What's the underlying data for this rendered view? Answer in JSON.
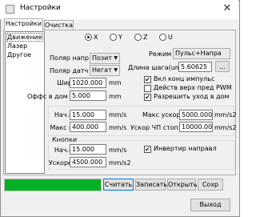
{
  "window": {
    "title": "Настройки",
    "close_glyph": "✕"
  },
  "tabs": [
    {
      "label": "Настройки"
    },
    {
      "label": "Очистка"
    }
  ],
  "sidebar": {
    "items": [
      {
        "label": "Движение"
      },
      {
        "label": "Лазер"
      },
      {
        "label": "Другое"
      }
    ],
    "selected": "Движение"
  },
  "axes": {
    "options": [
      "X",
      "Y",
      "Z",
      "U"
    ],
    "selected": "X"
  },
  "motion": {
    "polar_dir_label": "Поляр напр",
    "polar_dir_value": "Позит",
    "polar_sensor_label": "Поляр датч",
    "polar_sensor_value": "Негат",
    "mode_label": "Режим",
    "mode_value": "Пульс+Напра",
    "step_label": "Длина шага(um):",
    "step_value": "5.60625",
    "browse_label": "...",
    "width_label": "Ширина:",
    "width_value": "1020.000",
    "width_unit": "mm",
    "offset_label": "Оффс в дом",
    "offset_value": "5.000",
    "offset_unit": "mm",
    "checks": [
      {
        "label": "Вкл конц импульс",
        "checked": true
      },
      {
        "label": "Действ верх пред PWM",
        "checked": false
      },
      {
        "label": "Разрешить уход в дом",
        "checked": true
      }
    ]
  },
  "speed": {
    "start_label": "Нач.скор:",
    "start_value": "15.000",
    "start_unit": "mm/s",
    "max_label": "Макс скор:",
    "max_value": "400.000",
    "max_unit": "mm/s",
    "max_accel_label": "Макс ускор:",
    "max_accel_value": "5000.000",
    "max_accel_unit": "mm/s2",
    "stop_accel_label": "Ускор ЧП стоп:",
    "stop_accel_value": "10000.000",
    "stop_accel_unit": "mm/s2"
  },
  "buttons_group": {
    "title": "Кнопки",
    "start_label": "Нач.скор:",
    "start_value": "15.000",
    "start_unit": "mm/s",
    "accel_label": "Ускорение:",
    "accel_value": "4500.000",
    "accel_unit": "mm/s2",
    "invert_label": "Инвертир направл",
    "invert_checked": true
  },
  "actions": {
    "read": "Считать",
    "write": "Записать",
    "open": "Открыть",
    "save": "Сохр",
    "exit": "Выход"
  },
  "progress": {
    "fraction": 1.0,
    "color": "#06b025"
  }
}
